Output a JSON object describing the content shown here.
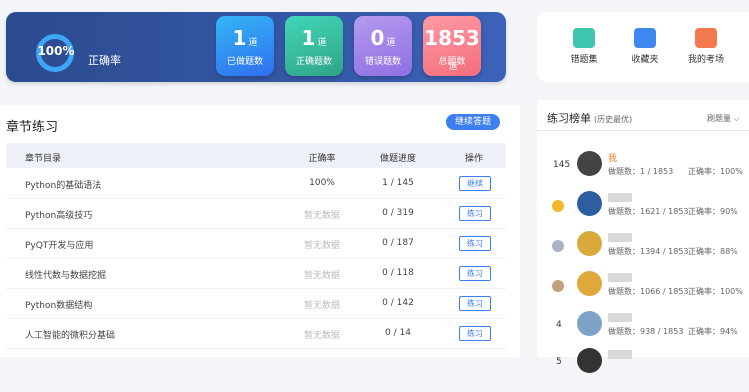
{
  "summary": {
    "accuracy": "100%",
    "accuracy_label": "正确率",
    "accuracy_progress": 1.0,
    "stats": [
      {
        "num": "1",
        "unit": "道",
        "label": "已做题数"
      },
      {
        "num": "1",
        "unit": "道",
        "label": "正确题数"
      },
      {
        "num": "0",
        "unit": "道",
        "label": "错误题数"
      },
      {
        "num": "1853",
        "unit": "道",
        "label": "总题数"
      }
    ]
  },
  "quick_links": [
    "错题集",
    "收藏夹",
    "我的考场"
  ],
  "chapters": {
    "title": "章节练习",
    "continue_label": "继续答题",
    "headers": {
      "name": "章节目录",
      "accuracy": "正确率",
      "progress": "做题进度",
      "action": "操作"
    },
    "rows": [
      {
        "name": "Python的基础语法",
        "accuracy": "100%",
        "progress": "1 / 145",
        "action": "继续"
      },
      {
        "name": "Python高级技巧",
        "accuracy": "暂无数据",
        "progress": "0 / 319",
        "action": "练习"
      },
      {
        "name": "PyQT开发与应用",
        "accuracy": "暂无数据",
        "progress": "0 / 187",
        "action": "练习"
      },
      {
        "name": "线性代数与数据挖掘",
        "accuracy": "暂无数据",
        "progress": "0 / 118",
        "action": "练习"
      },
      {
        "name": "Python数据结构",
        "accuracy": "暂无数据",
        "progress": "0 / 142",
        "action": "练习"
      },
      {
        "name": "人工智能的微积分基础",
        "accuracy": "暂无数据",
        "progress": "0 / 14",
        "action": "练习"
      }
    ]
  },
  "ranking": {
    "title": "练习榜单",
    "subtitle": "(历史最优)",
    "sort_label": "刷题量",
    "entries": [
      {
        "rank": "145",
        "name": "我",
        "done": "做题数：1 / 1853",
        "acc": "正确率：100%"
      },
      {
        "rank": "",
        "name": "",
        "done": "做题数：1621 / 1853",
        "acc": "正确率：90%"
      },
      {
        "rank": "",
        "name": "",
        "done": "做题数：1394 / 1853",
        "acc": "正确率：88%"
      },
      {
        "rank": "",
        "name": "",
        "done": "做题数：1066 / 1853",
        "acc": "正确率：100%"
      },
      {
        "rank": "4",
        "name": "",
        "done": "做题数：938 / 1853",
        "acc": "正确率：94%"
      },
      {
        "rank": "5",
        "name": "",
        "done": "",
        "acc": ""
      }
    ]
  }
}
